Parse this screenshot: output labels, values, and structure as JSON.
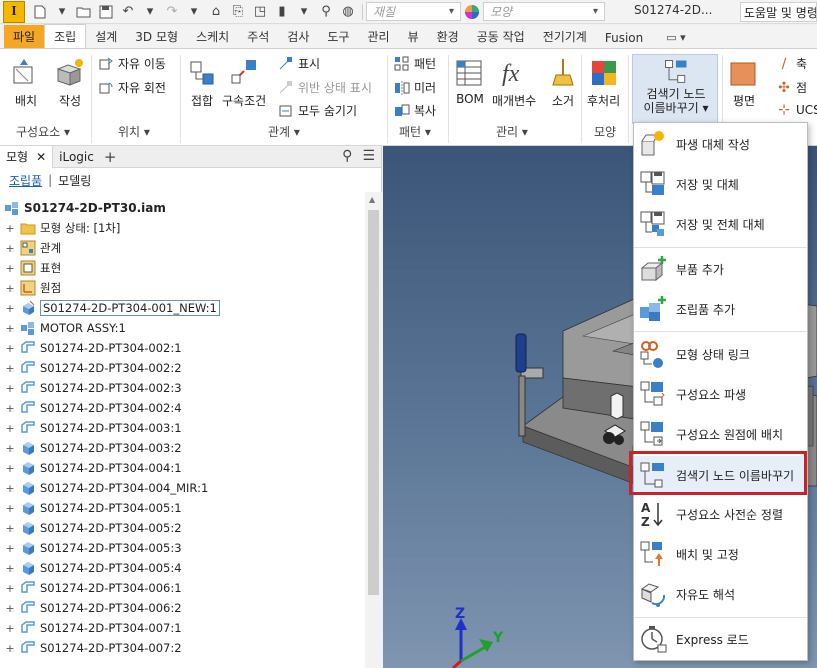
{
  "qat": {
    "logo": "I",
    "material_placeholder": "재질",
    "appearance_placeholder": "모양",
    "title": "S01274-2D...",
    "help_search": "도움말 및 명령"
  },
  "tabs": [
    "파일",
    "조립",
    "설계",
    "3D 모형",
    "스케치",
    "주석",
    "검사",
    "도구",
    "관리",
    "뷰",
    "환경",
    "공동 작업",
    "전기기계",
    "Fusion"
  ],
  "ribbon": {
    "component": {
      "place": "배치",
      "create": "작성",
      "label": "구성요소 ▾"
    },
    "position": {
      "free_move": "자유 이동",
      "free_rotate": "자유 회전",
      "label": "위치 ▾"
    },
    "relationships": {
      "joint": "접합",
      "constrain": "구속조건",
      "show": "표시",
      "show_sick": "위반 상태 표시",
      "hide_all": "모두 숨기기",
      "label": "관계 ▾"
    },
    "pattern": {
      "pattern": "패턴",
      "mirror": "미러",
      "copy": "복사",
      "label": "패턴 ▾"
    },
    "manage": {
      "bom": "BOM",
      "parameters": "매개변수",
      "clean": "소거",
      "label": "관리 ▾"
    },
    "productivity": {
      "post": "후처리",
      "label": "모양"
    },
    "rename": {
      "line1": "검색기 노드",
      "line2": "이름바꾸기 ▾"
    },
    "work": {
      "plane": "평면",
      "axis": "축",
      "point": "점",
      "ucs": "UCS"
    }
  },
  "browser": {
    "tab_model": "모형",
    "tab_ilogic": "iLogic",
    "sub_assembly": "조립품",
    "sub_modeling": "모델링",
    "root": "S01274-2D-PT30.iam",
    "nodes": [
      "모형 상태: [1차]",
      "관계",
      "표현",
      "원점",
      "S01274-2D-PT304-001_NEW:1",
      "MOTOR ASSY:1",
      "S01274-2D-PT304-002:1",
      "S01274-2D-PT304-002:2",
      "S01274-2D-PT304-002:3",
      "S01274-2D-PT304-002:4",
      "S01274-2D-PT304-003:1",
      "S01274-2D-PT304-003:2",
      "S01274-2D-PT304-004:1",
      "S01274-2D-PT304-004_MIR:1",
      "S01274-2D-PT304-005:1",
      "S01274-2D-PT304-005:2",
      "S01274-2D-PT304-005:3",
      "S01274-2D-PT304-005:4",
      "S01274-2D-PT304-006:1",
      "S01274-2D-PT304-006:2",
      "S01274-2D-PT304-007:1",
      "S01274-2D-PT304-007:2"
    ]
  },
  "menu": {
    "items": [
      "파생 대체 작성",
      "저장 및 대체",
      "저장 및 전체 대체",
      "부품 추가",
      "조립품 추가",
      "모형 상태 링크",
      "구성요소 파생",
      "구성요소 원점에 배치",
      "검색기 노드 이름바꾸기",
      "구성요소 사전순 정렬",
      "배치 및 고정",
      "자유도 해석",
      "Express 로드"
    ]
  },
  "viewcube": {
    "z": "Z",
    "y": "Y"
  },
  "colors": {
    "file_tab": "#f5a623",
    "highlight_box": "#c8232b",
    "viewport_top": "#3b5578",
    "viewport_bottom": "#7f95b0"
  }
}
